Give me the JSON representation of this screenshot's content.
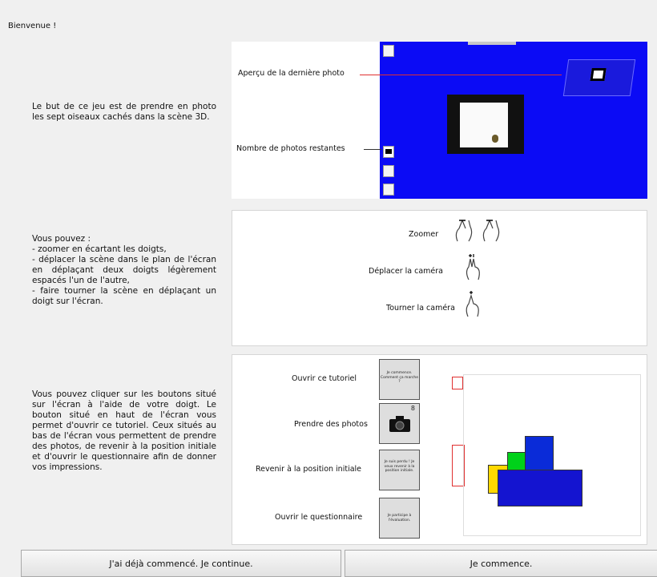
{
  "welcome": "Bienvenue !",
  "section1": {
    "text": "Le but de ce jeu est de prendre en photo les sept oiseaux cachés dans la scène 3D.",
    "label_preview": "Aperçu de la dernière photo",
    "label_remaining": "Nombre de photos restantes"
  },
  "section2": {
    "intro": "Vous pouvez :",
    "line1": "- zoomer en écartant les doigts,",
    "line2": "- déplacer la scène dans le plan de l'écran en déplaçant deux doigts légèrement espacés l'un de l'autre,",
    "line3": "- faire tourner la scène en déplaçant un doigt sur l'écran.",
    "label_zoom": "Zoomer",
    "label_move": "Déplacer la caméra",
    "label_rotate": "Tourner la caméra"
  },
  "section3": {
    "text": "Vous pouvez cliquer sur les boutons situé sur l'écran à l'aide de votre doigt. Le bouton situé en haut de l'écran vous permet d'ouvrir ce tutoriel. Ceux situés au bas de l'écran vous permettent de prendre des photos, de revenir à la position initiale et d'ouvrir le questionnaire afin de donner vos impressions.",
    "label_tutorial": "Ouvrir ce tutoriel",
    "label_photos": "Prendre des photos",
    "label_reset": "Revenir à la position initiale",
    "label_survey": "Ouvrir le questionnaire",
    "btn_tutorial_text": "Je commence. Comment ça marche ?",
    "btn_photo_count": "8",
    "btn_reset_text": "Je suis perdu ! Je veux revenir à la position initiale.",
    "btn_survey_text": "Je participe à l'évaluation."
  },
  "buttons": {
    "continue": "J'ai déjà commencé. Je continue.",
    "start": "Je commence."
  },
  "colors": {
    "scene_blue": "#0b0bf5",
    "annotation_red": "#e03030"
  }
}
